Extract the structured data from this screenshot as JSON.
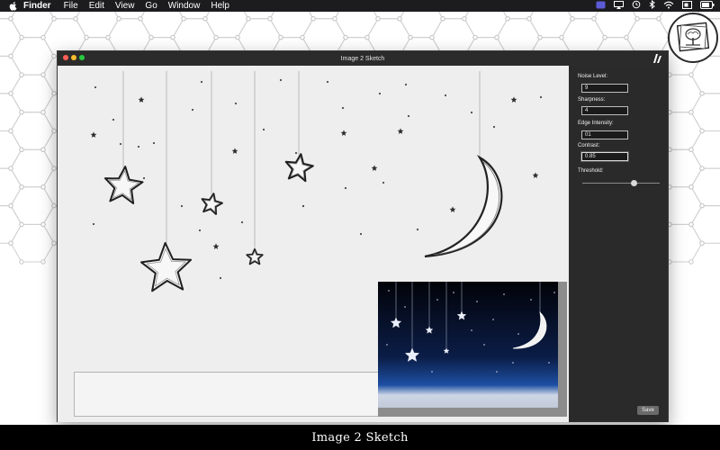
{
  "menubar": {
    "items": [
      {
        "label": "Finder",
        "bold": true
      },
      {
        "label": "File"
      },
      {
        "label": "Edit"
      },
      {
        "label": "View"
      },
      {
        "label": "Go"
      },
      {
        "label": "Window"
      },
      {
        "label": "Help"
      }
    ],
    "status_icons": [
      "app-status-icon",
      "airplay-icon",
      "time-machine-icon",
      "bluetooth-icon",
      "wifi-icon",
      "display-icon",
      "battery-icon"
    ]
  },
  "window": {
    "title": "Image 2 Sketch",
    "traffic_colors": [
      "#ff5f57",
      "#febc2e",
      "#28c840"
    ]
  },
  "controls": {
    "noise_level": {
      "label": "Noise Level:",
      "value": "9"
    },
    "sharpness": {
      "label": "Sharpness:",
      "value": "4"
    },
    "edge_intensity": {
      "label": "Edge Intensity:",
      "value": "01"
    },
    "contrast": {
      "label": "Contrast:",
      "value": "0.85"
    },
    "threshold": {
      "label": "Threshold:",
      "value_fraction": 0.67
    }
  },
  "save_label": "Save",
  "caption": "Image 2 Sketch",
  "colors": {
    "menubar": "#1c1c1e",
    "sidebar": "#2a2a2a",
    "night_top": "#020308",
    "night_bottom": "#1d4fa3"
  }
}
